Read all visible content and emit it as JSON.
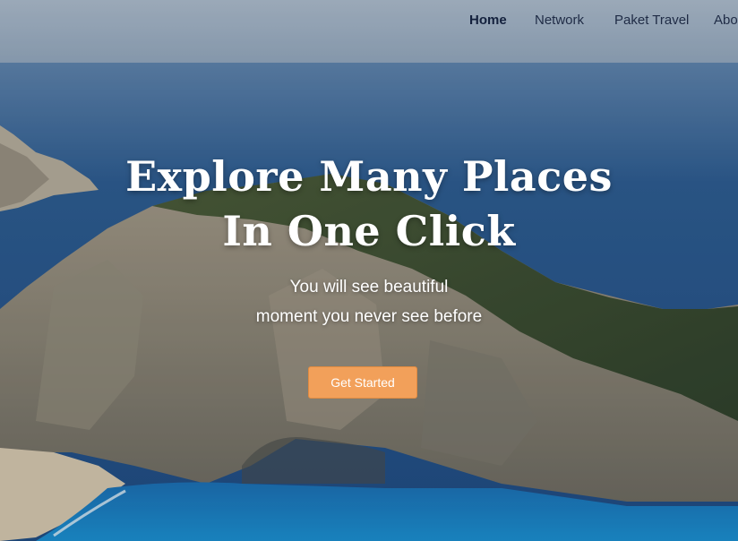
{
  "nav": {
    "items": [
      {
        "label": "Home",
        "active": true
      },
      {
        "label": "Network",
        "active": false
      },
      {
        "label": "Paket Travel",
        "active": false
      },
      {
        "label": "About",
        "active": false
      }
    ]
  },
  "hero": {
    "title_line1": "Explore Many Places",
    "title_line2": "In One Click",
    "subtitle_line1": "You will see beautiful",
    "subtitle_line2": "moment you never see before",
    "cta_label": "Get Started"
  },
  "colors": {
    "cta": "#f2a05a",
    "nav_text": "#1f2b45",
    "sea": "#1f4f86",
    "sky": "#a9b8c7"
  }
}
